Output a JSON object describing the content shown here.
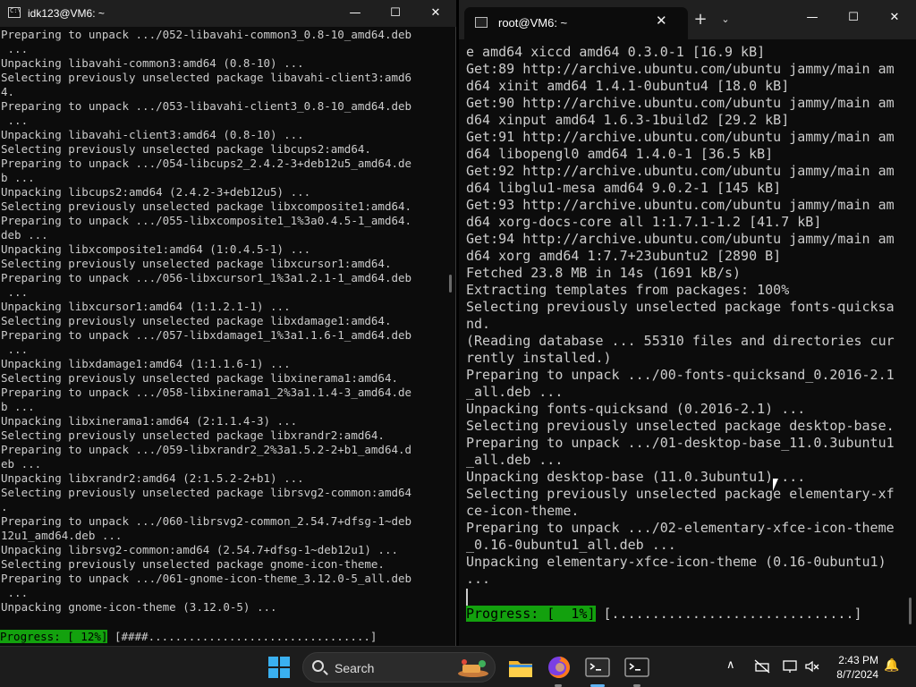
{
  "left_window": {
    "title": "idk123@VM6: ~",
    "minimize": "—",
    "maximize": "☐",
    "close": "✕",
    "lines": [
      "Preparing to unpack .../052-libavahi-common3_0.8-10_amd64.deb",
      " ...",
      "Unpacking libavahi-common3:amd64 (0.8-10) ...",
      "Selecting previously unselected package libavahi-client3:amd6",
      "4.",
      "Preparing to unpack .../053-libavahi-client3_0.8-10_amd64.deb",
      " ...",
      "Unpacking libavahi-client3:amd64 (0.8-10) ...",
      "Selecting previously unselected package libcups2:amd64.",
      "Preparing to unpack .../054-libcups2_2.4.2-3+deb12u5_amd64.de",
      "b ...",
      "Unpacking libcups2:amd64 (2.4.2-3+deb12u5) ...",
      "Selecting previously unselected package libxcomposite1:amd64.",
      "Preparing to unpack .../055-libxcomposite1_1%3a0.4.5-1_amd64.",
      "deb ...",
      "Unpacking libxcomposite1:amd64 (1:0.4.5-1) ...",
      "Selecting previously unselected package libxcursor1:amd64.",
      "Preparing to unpack .../056-libxcursor1_1%3a1.2.1-1_amd64.deb",
      " ...",
      "Unpacking libxcursor1:amd64 (1:1.2.1-1) ...",
      "Selecting previously unselected package libxdamage1:amd64.",
      "Preparing to unpack .../057-libxdamage1_1%3a1.1.6-1_amd64.deb",
      " ...",
      "Unpacking libxdamage1:amd64 (1:1.1.6-1) ...",
      "Selecting previously unselected package libxinerama1:amd64.",
      "Preparing to unpack .../058-libxinerama1_2%3a1.1.4-3_amd64.de",
      "b ...",
      "Unpacking libxinerama1:amd64 (2:1.1.4-3) ...",
      "Selecting previously unselected package libxrandr2:amd64.",
      "Preparing to unpack .../059-libxrandr2_2%3a1.5.2-2+b1_amd64.d",
      "eb ...",
      "Unpacking libxrandr2:amd64 (2:1.5.2-2+b1) ...",
      "Selecting previously unselected package librsvg2-common:amd64",
      ".",
      "Preparing to unpack .../060-librsvg2-common_2.54.7+dfsg-1~deb",
      "12u1_amd64.deb ...",
      "Unpacking librsvg2-common:amd64 (2.54.7+dfsg-1~deb12u1) ...",
      "Selecting previously unselected package gnome-icon-theme.",
      "Preparing to unpack .../061-gnome-icon-theme_3.12.0-5_all.deb",
      " ...",
      "Unpacking gnome-icon-theme (3.12.0-5) ..."
    ],
    "progress_label": "Progress: [ 12%]",
    "progress_bar": " [####.................................]",
    "progress_percent": 12
  },
  "right_window": {
    "tab_title": "root@VM6: ~",
    "tab_close": "✕",
    "new_tab": "+",
    "dropdown": "⌄",
    "minimize": "—",
    "maximize": "☐",
    "close": "✕",
    "lines": [
      "e amd64 xiccd amd64 0.3.0-1 [16.9 kB]",
      "Get:89 http://archive.ubuntu.com/ubuntu jammy/main am",
      "d64 xinit amd64 1.4.1-0ubuntu4 [18.0 kB]",
      "Get:90 http://archive.ubuntu.com/ubuntu jammy/main am",
      "d64 xinput amd64 1.6.3-1build2 [29.2 kB]",
      "Get:91 http://archive.ubuntu.com/ubuntu jammy/main am",
      "d64 libopengl0 amd64 1.4.0-1 [36.5 kB]",
      "Get:92 http://archive.ubuntu.com/ubuntu jammy/main am",
      "d64 libglu1-mesa amd64 9.0.2-1 [145 kB]",
      "Get:93 http://archive.ubuntu.com/ubuntu jammy/main am",
      "d64 xorg-docs-core all 1:1.7.1-1.2 [41.7 kB]",
      "Get:94 http://archive.ubuntu.com/ubuntu jammy/main am",
      "d64 xorg amd64 1:7.7+23ubuntu2 [2890 B]",
      "Fetched 23.8 MB in 14s (1691 kB/s)",
      "Extracting templates from packages: 100%",
      "Selecting previously unselected package fonts-quicksa",
      "nd.",
      "(Reading database ... 55310 files and directories cur",
      "rently installed.)",
      "Preparing to unpack .../00-fonts-quicksand_0.2016-2.1",
      "_all.deb ...",
      "Unpacking fonts-quicksand (0.2016-2.1) ...",
      "Selecting previously unselected package desktop-base.",
      "Preparing to unpack .../01-desktop-base_11.0.3ubuntu1",
      "_all.deb ...",
      "Unpacking desktop-base (11.0.3ubuntu1) ...",
      "Selecting previously unselected package elementary-xf",
      "ce-icon-theme.",
      "Preparing to unpack .../02-elementary-xfce-icon-theme",
      "_0.16-0ubuntu1_all.deb ...",
      "Unpacking elementary-xfce-icon-theme (0.16-0ubuntu1)",
      "..."
    ],
    "progress_label": "Progress: [  1%]",
    "progress_bar": " [..............................]",
    "progress_percent": 1
  },
  "taskbar": {
    "search_label": "Search",
    "time": "2:43 PM",
    "date": "8/7/2024",
    "apps": [
      "file-explorer-icon",
      "firefox-icon",
      "terminal-icon",
      "terminal-2-icon"
    ],
    "tray": {
      "chevron": "∧",
      "notification_bell": "🔔"
    }
  },
  "colors": {
    "terminal_bg": "#0c0c0c",
    "terminal_text": "#cccccc",
    "progress_green": "#13a10e",
    "taskbar_bg": "#1c1c1c",
    "start_blue": "#3ab0f0"
  }
}
